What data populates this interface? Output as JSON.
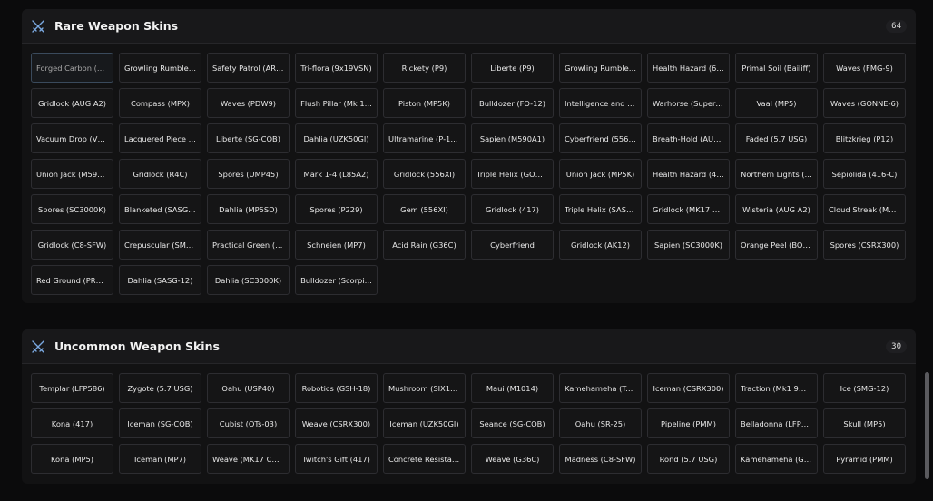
{
  "sections": [
    {
      "title": "Rare Weapon Skins",
      "count": "64",
      "icon": "crossed-swords-icon",
      "items": [
        "Forged Carbon (S…",
        "Growling Rumble …",
        "Safety Patrol (AR33)",
        "Tri-flora (9x19VSN)",
        "Rickety (P9)",
        "Liberte (P9)",
        "Growling Rumble …",
        "Health Hazard (6P…",
        "Primal Soil (Bailiff)",
        "Waves (FMG-9)",
        "Gridlock (AUG A2)",
        "Compass (MPX)",
        "Waves (PDW9)",
        "Flush Pillar (Mk 1…",
        "Piston (MP5K)",
        "Bulldozer (FO-12)",
        "Intelligence and S…",
        "Warhorse (Super …",
        "Vaal (MP5)",
        "Waves (GONNE-6)",
        "Vacuum Drop (V3…",
        "Lacquered Piece (…",
        "Liberte (SG-CQB)",
        "Dahlia (UZK50GI)",
        "Ultramarine (P-10C)",
        "Sapien (M590A1)",
        "Cyberfriend (556XI)",
        "Breath-Hold (AUG…",
        "Faded (5.7 USG)",
        "Blitzkrieg (P12)",
        "Union Jack (M590…",
        "Gridlock (R4C)",
        "Spores (UMP45)",
        "Mark 1-4 (L85A2)",
        "Gridlock (556XI)",
        "Triple Helix (GON…",
        "Union Jack (MP5K)",
        "Health Hazard (41…",
        "Northern Lights (…",
        "Sepiolida (416-C)",
        "Spores (SC3000K)",
        "Blanketed (SASG-…",
        "Dahlia (MP5SD)",
        "Spores (P229)",
        "Gem (556XI)",
        "Gridlock (417)",
        "Triple Helix (SASG…",
        "Gridlock (MK17 C…",
        "Wisteria (AUG A2)",
        "Cloud Streak (Mk…",
        "Gridlock (C8-SFW)",
        "Crepuscular (SMG…",
        "Practical Green (U…",
        "Schneien (MP7)",
        "Acid Rain (G36C)",
        "Cyberfriend",
        "Gridlock (AK12)",
        "Sapien (SC3000K)",
        "Orange Peel (BOS…",
        "Spores (CSRX300)",
        "Red Ground (PRB…",
        "Dahlia (SASG-12)",
        "Dahlia (SC3000K)",
        "Bulldozer (Scorpi…"
      ]
    },
    {
      "title": "Uncommon Weapon Skins",
      "count": "30",
      "icon": "crossed-swords-icon",
      "items": [
        "Templar (LFP586)",
        "Zygote (5.7 USG)",
        "Oahu (USP40)",
        "Robotics (GSH-18)",
        "Mushroom (SIX12…",
        "Maui (M1014)",
        "Kamehameha (Ty…",
        "Iceman (CSRX300)",
        "Traction (Mk1 9m…",
        "Ice (SMG-12)",
        "Kona (417)",
        "Iceman (SG-CQB)",
        "Cubist (OTs-03)",
        "Weave (CSRX300)",
        "Iceman (UZK50GI)",
        "Seance (SG-CQB)",
        "Oahu (SR-25)",
        "Pipeline (PMM)",
        "Belladonna (LFPS…",
        "Skull (MP5)",
        "Kona (MP5)",
        "Iceman (MP7)",
        "Weave (MK17 CQB)",
        "Twitch's Gift (417)",
        "Concrete Resistan…",
        "Weave (G36C)",
        "Madness (C8-SFW)",
        "Rond (5.7 USG)",
        "Kamehameha (GO…",
        "Pyramid (PMM)"
      ]
    }
  ],
  "colors": {
    "background": "#0b0b0c",
    "panel": "#121213",
    "accent_icon": "#7aa8e0",
    "button_border": "#2d2d31"
  }
}
